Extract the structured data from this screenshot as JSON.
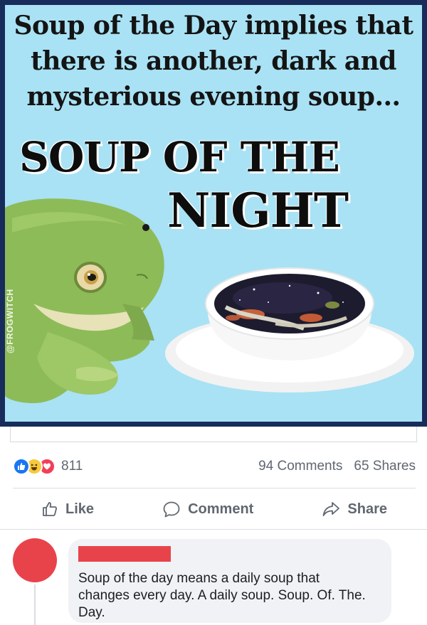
{
  "meme": {
    "top_text": "Soup of the Day implies that there is another, dark and mysterious evening soup...",
    "title_line_1": "SOUP OF THE",
    "title_line_2": "NIGHT",
    "watermark": "@FROGWITCH",
    "colors": {
      "frame": "#182c5c",
      "background": "#a9e2f4"
    }
  },
  "post": {
    "reaction_count": "811",
    "reactions": [
      "like-icon",
      "haha-icon",
      "love-icon"
    ],
    "comments_count": "94 Comments",
    "shares_count": "65 Shares",
    "actions": {
      "like": "Like",
      "comment": "Comment",
      "share": "Share"
    }
  },
  "comment": {
    "text": "Soup of the day means a daily soup that changes every day. A daily soup. Soup. Of. The. Day.",
    "colors": {
      "avatar": "#e8434b",
      "redaction": "#e8434b"
    }
  }
}
